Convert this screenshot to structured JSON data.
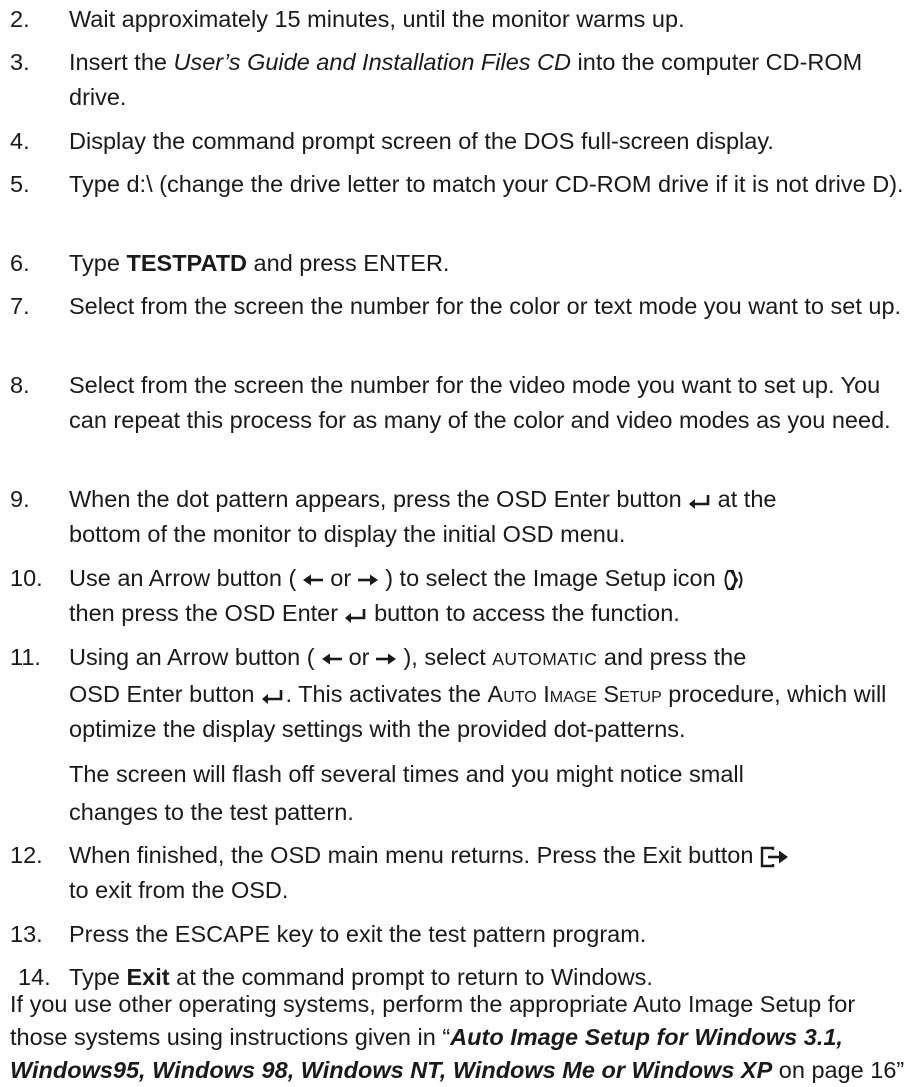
{
  "steps": [
    {
      "num": "2.",
      "parts": [
        "Wait approximately 15 minutes, until the monitor warms up."
      ]
    },
    {
      "num": "3.",
      "parts": [
        "Insert the ",
        "User’s Guide and Installation Files CD",
        " into the computer CD-ROM drive."
      ]
    },
    {
      "num": "4.",
      "parts": [
        "Display the command prompt screen of the DOS full-screen display."
      ]
    },
    {
      "num": "5.",
      "parts": [
        "Type d:\\ (change the drive letter to match your CD-ROM drive if it is not drive D)."
      ]
    },
    {
      "num": "6.",
      "parts": [
        "Type ",
        "TESTPATD",
        " and press ENTER."
      ]
    },
    {
      "num": "7.",
      "parts": [
        "Select from the screen the number for the color or text mode you want to set up."
      ]
    },
    {
      "num": "8.",
      "parts": [
        "Select from the screen the number for the video mode you want to set up.  You can repeat this process for as many of the color and video modes as you need."
      ]
    },
    {
      "num": "9.",
      "parts": [
        "When the dot pattern appears, press the OSD Enter button",
        "at the",
        "bottom of the monitor to display the initial OSD menu."
      ]
    },
    {
      "num": "10.",
      "parts": [
        "Use an Arrow button (",
        "or",
        ") to select the Image Setup icon",
        "then press the OSD Enter",
        "button to access the function."
      ]
    },
    {
      "num": "11.",
      "parts": [
        "Using an Arrow button (",
        "or",
        "), select ",
        "AUTOMATIC",
        " and press the",
        "OSD Enter button",
        ". This activates the ",
        "Auto Image Setup",
        " procedure, which will optimize the display settings with the provided dot-patterns.",
        "The screen will flash off several times and you might notice small",
        "changes to the test pattern."
      ]
    },
    {
      "num": "12.",
      "parts": [
        "When finished, the OSD main menu returns. Press the Exit button",
        "to exit from the OSD."
      ]
    },
    {
      "num": "13.",
      "parts": [
        "Press the ESCAPE key to exit the test pattern program."
      ]
    },
    {
      "num": "14.",
      "parts": [
        "Type ",
        "Exit",
        " at the command prompt to return to Windows."
      ]
    }
  ],
  "closing": {
    "lead": "If you use other operating systems, perform the appropriate Auto Image Setup for those systems using instructions given in “",
    "ref": "Auto Image Setup for Windows 3.1, Windows95, Windows 98, Windows NT, Windows Me or Windows XP",
    "tail": " on page 16”"
  },
  "icons": {
    "enter": "enter-key-icon",
    "left": "left-arrow-icon",
    "right": "right-arrow-icon",
    "image_setup": "image-setup-icon",
    "exit": "exit-icon"
  }
}
